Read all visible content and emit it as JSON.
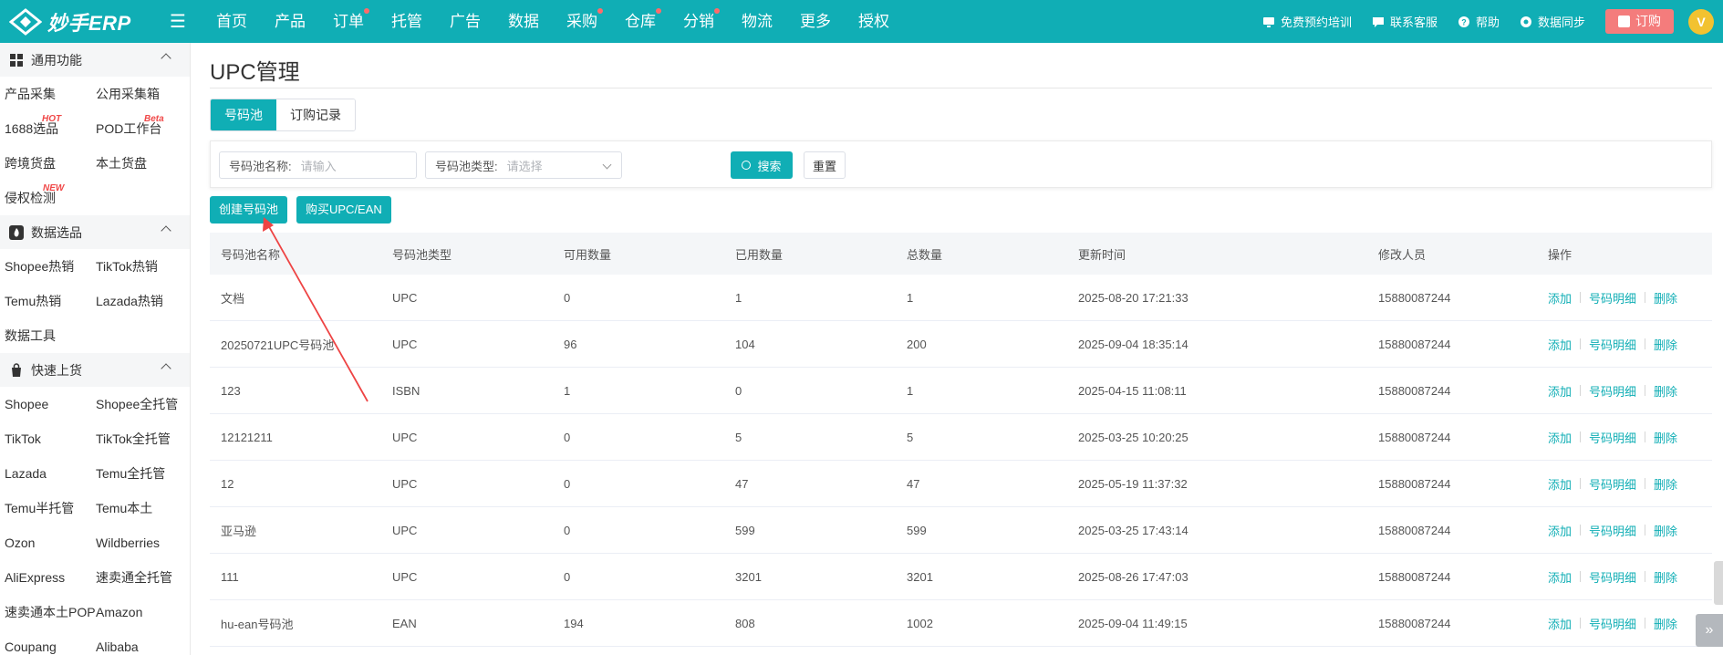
{
  "brand": {
    "name": "妙手ERP",
    "accent": "#10aeb5"
  },
  "nav": [
    {
      "label": "首页",
      "dot": false
    },
    {
      "label": "产品",
      "dot": false
    },
    {
      "label": "订单",
      "dot": true
    },
    {
      "label": "托管",
      "dot": false
    },
    {
      "label": "广告",
      "dot": false
    },
    {
      "label": "数据",
      "dot": false
    },
    {
      "label": "采购",
      "dot": true
    },
    {
      "label": "仓库",
      "dot": true
    },
    {
      "label": "分销",
      "dot": true
    },
    {
      "label": "物流",
      "dot": false
    },
    {
      "label": "更多",
      "dot": false
    },
    {
      "label": "授权",
      "dot": false
    }
  ],
  "topRight": {
    "training": "免费预约培训",
    "support": "联系客服",
    "help": "帮助",
    "sync": "数据同步",
    "order": "订购"
  },
  "sidebar": {
    "groups": [
      {
        "title": "通用功能",
        "icon": "grid-icon",
        "items": [
          {
            "label": "产品采集",
            "tag": ""
          },
          {
            "label": "公用采集箱",
            "tag": ""
          },
          {
            "label": "1688选品",
            "tag": "HOT"
          },
          {
            "label": "POD工作台",
            "tag": "Beta"
          },
          {
            "label": "跨境货盘",
            "tag": ""
          },
          {
            "label": "本土货盘",
            "tag": ""
          },
          {
            "label": "侵权检测",
            "tag": "NEW"
          }
        ]
      },
      {
        "title": "数据选品",
        "icon": "fire-icon",
        "items": [
          {
            "label": "Shopee热销",
            "tag": ""
          },
          {
            "label": "TikTok热销",
            "tag": ""
          },
          {
            "label": "Temu热销",
            "tag": ""
          },
          {
            "label": "Lazada热销",
            "tag": ""
          },
          {
            "label": "数据工具",
            "tag": ""
          }
        ]
      },
      {
        "title": "快速上货",
        "icon": "bag-icon",
        "items": [
          {
            "label": "Shopee",
            "tag": ""
          },
          {
            "label": "Shopee全托管",
            "tag": ""
          },
          {
            "label": "TikTok",
            "tag": ""
          },
          {
            "label": "TikTok全托管",
            "tag": ""
          },
          {
            "label": "Lazada",
            "tag": ""
          },
          {
            "label": "Temu全托管",
            "tag": ""
          },
          {
            "label": "Temu半托管",
            "tag": ""
          },
          {
            "label": "Temu本土",
            "tag": ""
          },
          {
            "label": "Ozon",
            "tag": ""
          },
          {
            "label": "Wildberries",
            "tag": ""
          },
          {
            "label": "AliExpress",
            "tag": ""
          },
          {
            "label": "速卖通全托管",
            "tag": ""
          },
          {
            "label": "速卖通本土POP",
            "tag": ""
          },
          {
            "label": "Amazon",
            "tag": ""
          },
          {
            "label": "Coupang",
            "tag": ""
          },
          {
            "label": "Alibaba",
            "tag": ""
          }
        ]
      }
    ]
  },
  "page": {
    "title": "UPC管理",
    "tabs": [
      "号码池",
      "订购记录"
    ],
    "filters": {
      "name_label": "号码池名称:",
      "name_placeholder": "请输入",
      "type_label": "号码池类型:",
      "type_placeholder": "请选择",
      "search": "搜索",
      "reset": "重置"
    },
    "actions": {
      "create": "创建号码池",
      "buy": "购买UPC/EAN"
    }
  },
  "table": {
    "headers": [
      "号码池名称",
      "号码池类型",
      "可用数量",
      "已用数量",
      "总数量",
      "更新时间",
      "修改人员",
      "操作"
    ],
    "ops": [
      "添加",
      "号码明细",
      "删除"
    ],
    "rows": [
      [
        "文档",
        "UPC",
        "0",
        "1",
        "1",
        "2025-08-20 17:21:33",
        "15880087244"
      ],
      [
        "20250721UPC号码池",
        "UPC",
        "96",
        "104",
        "200",
        "2025-09-04 18:35:14",
        "15880087244"
      ],
      [
        "123",
        "ISBN",
        "1",
        "0",
        "1",
        "2025-04-15 11:08:11",
        "15880087244"
      ],
      [
        "12121211",
        "UPC",
        "0",
        "5",
        "5",
        "2025-03-25 10:20:25",
        "15880087244"
      ],
      [
        "12",
        "UPC",
        "0",
        "47",
        "47",
        "2025-05-19 11:37:32",
        "15880087244"
      ],
      [
        "亚马逊",
        "UPC",
        "0",
        "599",
        "599",
        "2025-03-25 17:43:14",
        "15880087244"
      ],
      [
        "111",
        "UPC",
        "0",
        "3201",
        "3201",
        "2025-08-26 17:47:03",
        "15880087244"
      ],
      [
        "hu-ean号码池",
        "EAN",
        "194",
        "808",
        "1002",
        "2025-09-04 11:49:15",
        "15880087244"
      ]
    ]
  }
}
